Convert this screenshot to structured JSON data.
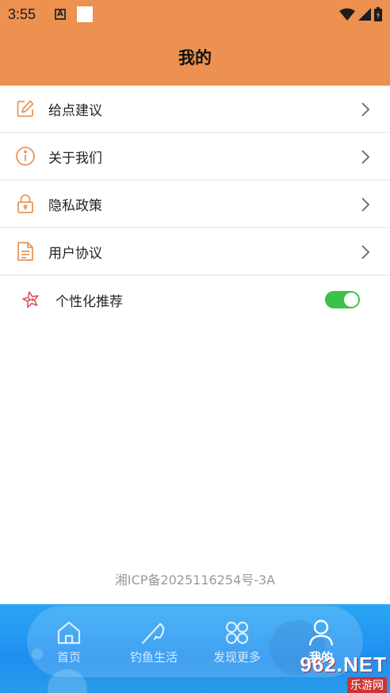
{
  "status_bar": {
    "time": "3:55",
    "notification_letter": "A"
  },
  "header": {
    "title": "我的"
  },
  "menu": {
    "items": [
      {
        "label": "给点建议",
        "icon": "edit-icon"
      },
      {
        "label": "关于我们",
        "icon": "info-icon"
      },
      {
        "label": "隐私政策",
        "icon": "lock-icon"
      },
      {
        "label": "用户协议",
        "icon": "document-icon"
      }
    ],
    "toggle": {
      "label": "个性化推荐",
      "icon": "star-icon",
      "enabled": true
    }
  },
  "footer": {
    "icp": "湘ICP备2025116254号-3A"
  },
  "tabbar": {
    "tabs": [
      {
        "label": "首页",
        "icon": "home-icon",
        "active": false
      },
      {
        "label": "钓鱼生活",
        "icon": "fishing-icon",
        "active": false
      },
      {
        "label": "发现更多",
        "icon": "grid-icon",
        "active": false
      },
      {
        "label": "我的",
        "icon": "user-icon",
        "active": true
      }
    ]
  },
  "watermark": {
    "brand": "962.NET",
    "tagline": "乐游网"
  },
  "colors": {
    "header_bg": "#ec9150",
    "accent_icon": "#e8955a",
    "toggle_on": "#3ac24a",
    "tabbar_bg": "#1e8ff0"
  }
}
